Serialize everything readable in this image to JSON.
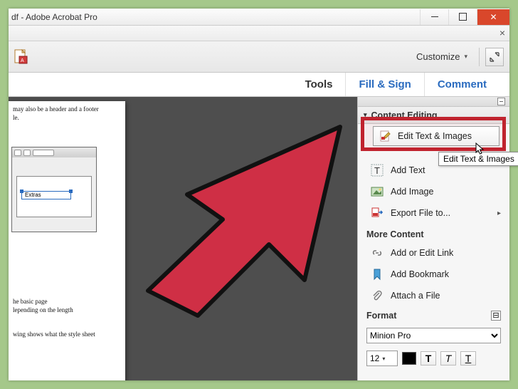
{
  "window": {
    "title": "df - Adobe Acrobat Pro",
    "close_x": "×"
  },
  "toolbar": {
    "customize_label": "Customize"
  },
  "tabs": {
    "tools": "Tools",
    "fill_sign": "Fill & Sign",
    "comment": "Comment"
  },
  "panel": {
    "section": "Content Editing",
    "edit_text_images": "Edit Text & Images",
    "tooltip": "Edit Text & Images",
    "add_text": "Add Text",
    "add_image": "Add Image",
    "export_file": "Export File to...",
    "more_content": "More Content",
    "add_edit_link": "Add or Edit Link",
    "add_bookmark": "Add Bookmark",
    "attach_file": "Attach a File",
    "format": "Format",
    "font": "Minion Pro",
    "font_size": "12",
    "collapse_glyph": "⊟"
  },
  "doc": {
    "line1": "may also be a header and a footer",
    "line2": "le.",
    "line3": "he basic page",
    "line4": "lepending on the length",
    "line5": "wing shows what the style sheet",
    "sel_label": "Extras"
  },
  "icons": {
    "triangle_down": "▾",
    "chevron_right": "▸",
    "t_glyph": "T"
  }
}
